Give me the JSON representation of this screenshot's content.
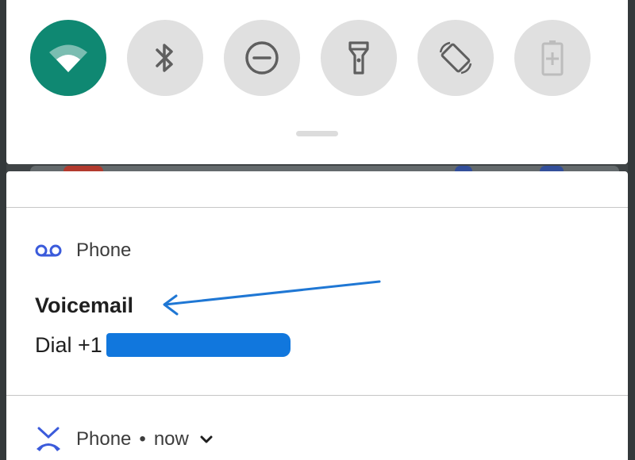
{
  "quick_settings": {
    "tiles": [
      {
        "icon": "wifi-icon",
        "state": "on"
      },
      {
        "icon": "bluetooth-icon",
        "state": "off"
      },
      {
        "icon": "do-not-disturb-icon",
        "state": "off"
      },
      {
        "icon": "flashlight-icon",
        "state": "off"
      },
      {
        "icon": "auto-rotate-icon",
        "state": "off"
      },
      {
        "icon": "battery-saver-icon",
        "state": "disabled"
      }
    ]
  },
  "colors": {
    "tile_active": "#0f8872",
    "tile_inactive": "#e0e0e0",
    "phone_icon": "#3b5bdb",
    "annotation": "#1f77d4"
  },
  "notifications": [
    {
      "app_icon": "voicemail-icon",
      "app_name": "Phone",
      "title": "Voicemail",
      "body": "Dial +1"
    },
    {
      "app_icon": "missed-call-icon",
      "app_name": "Phone",
      "separator": "•",
      "time": "now",
      "expand_icon": "chevron-down-icon"
    }
  ]
}
